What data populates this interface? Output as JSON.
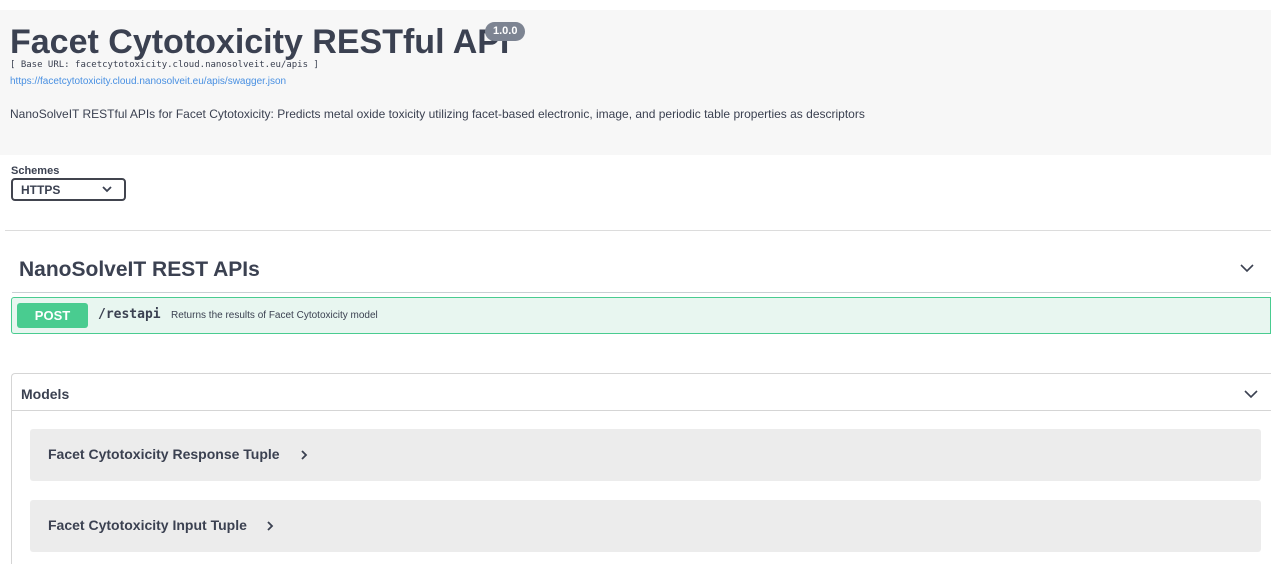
{
  "info": {
    "title": "Facet Cytotoxicity RESTful API",
    "version": "1.0.0",
    "base_url": "[ Base URL: facetcytotoxicity.cloud.nanosolveit.eu/apis ]",
    "spec_link": "https://facetcytotoxicity.cloud.nanosolveit.eu/apis/swagger.json",
    "description": "NanoSolveIT RESTful APIs for Facet Cytotoxicity: Predicts metal oxide toxicity utilizing facet-based electronic, image, and periodic table properties as descriptors"
  },
  "schemes": {
    "label": "Schemes",
    "selected": "HTTPS"
  },
  "tag": {
    "title": "NanoSolveIT REST APIs",
    "operation": {
      "method": "POST",
      "path": "/restapi",
      "summary": "Returns the results of Facet Cytotoxicity model"
    }
  },
  "models": {
    "title": "Models",
    "items": [
      {
        "name": "Facet Cytotoxicity Response Tuple"
      },
      {
        "name": "Facet Cytotoxicity Input Tuple"
      }
    ]
  },
  "colors": {
    "post_accent": "#49cc90",
    "post_background": "#e8f6f0",
    "link": "#4990e2",
    "text": "#3b4151"
  },
  "icons": {
    "schemes_select": "chevron-down-icon",
    "tag_toggle": "chevron-down-icon",
    "models_toggle": "chevron-down-icon",
    "model_expand": "chevron-right-icon"
  }
}
